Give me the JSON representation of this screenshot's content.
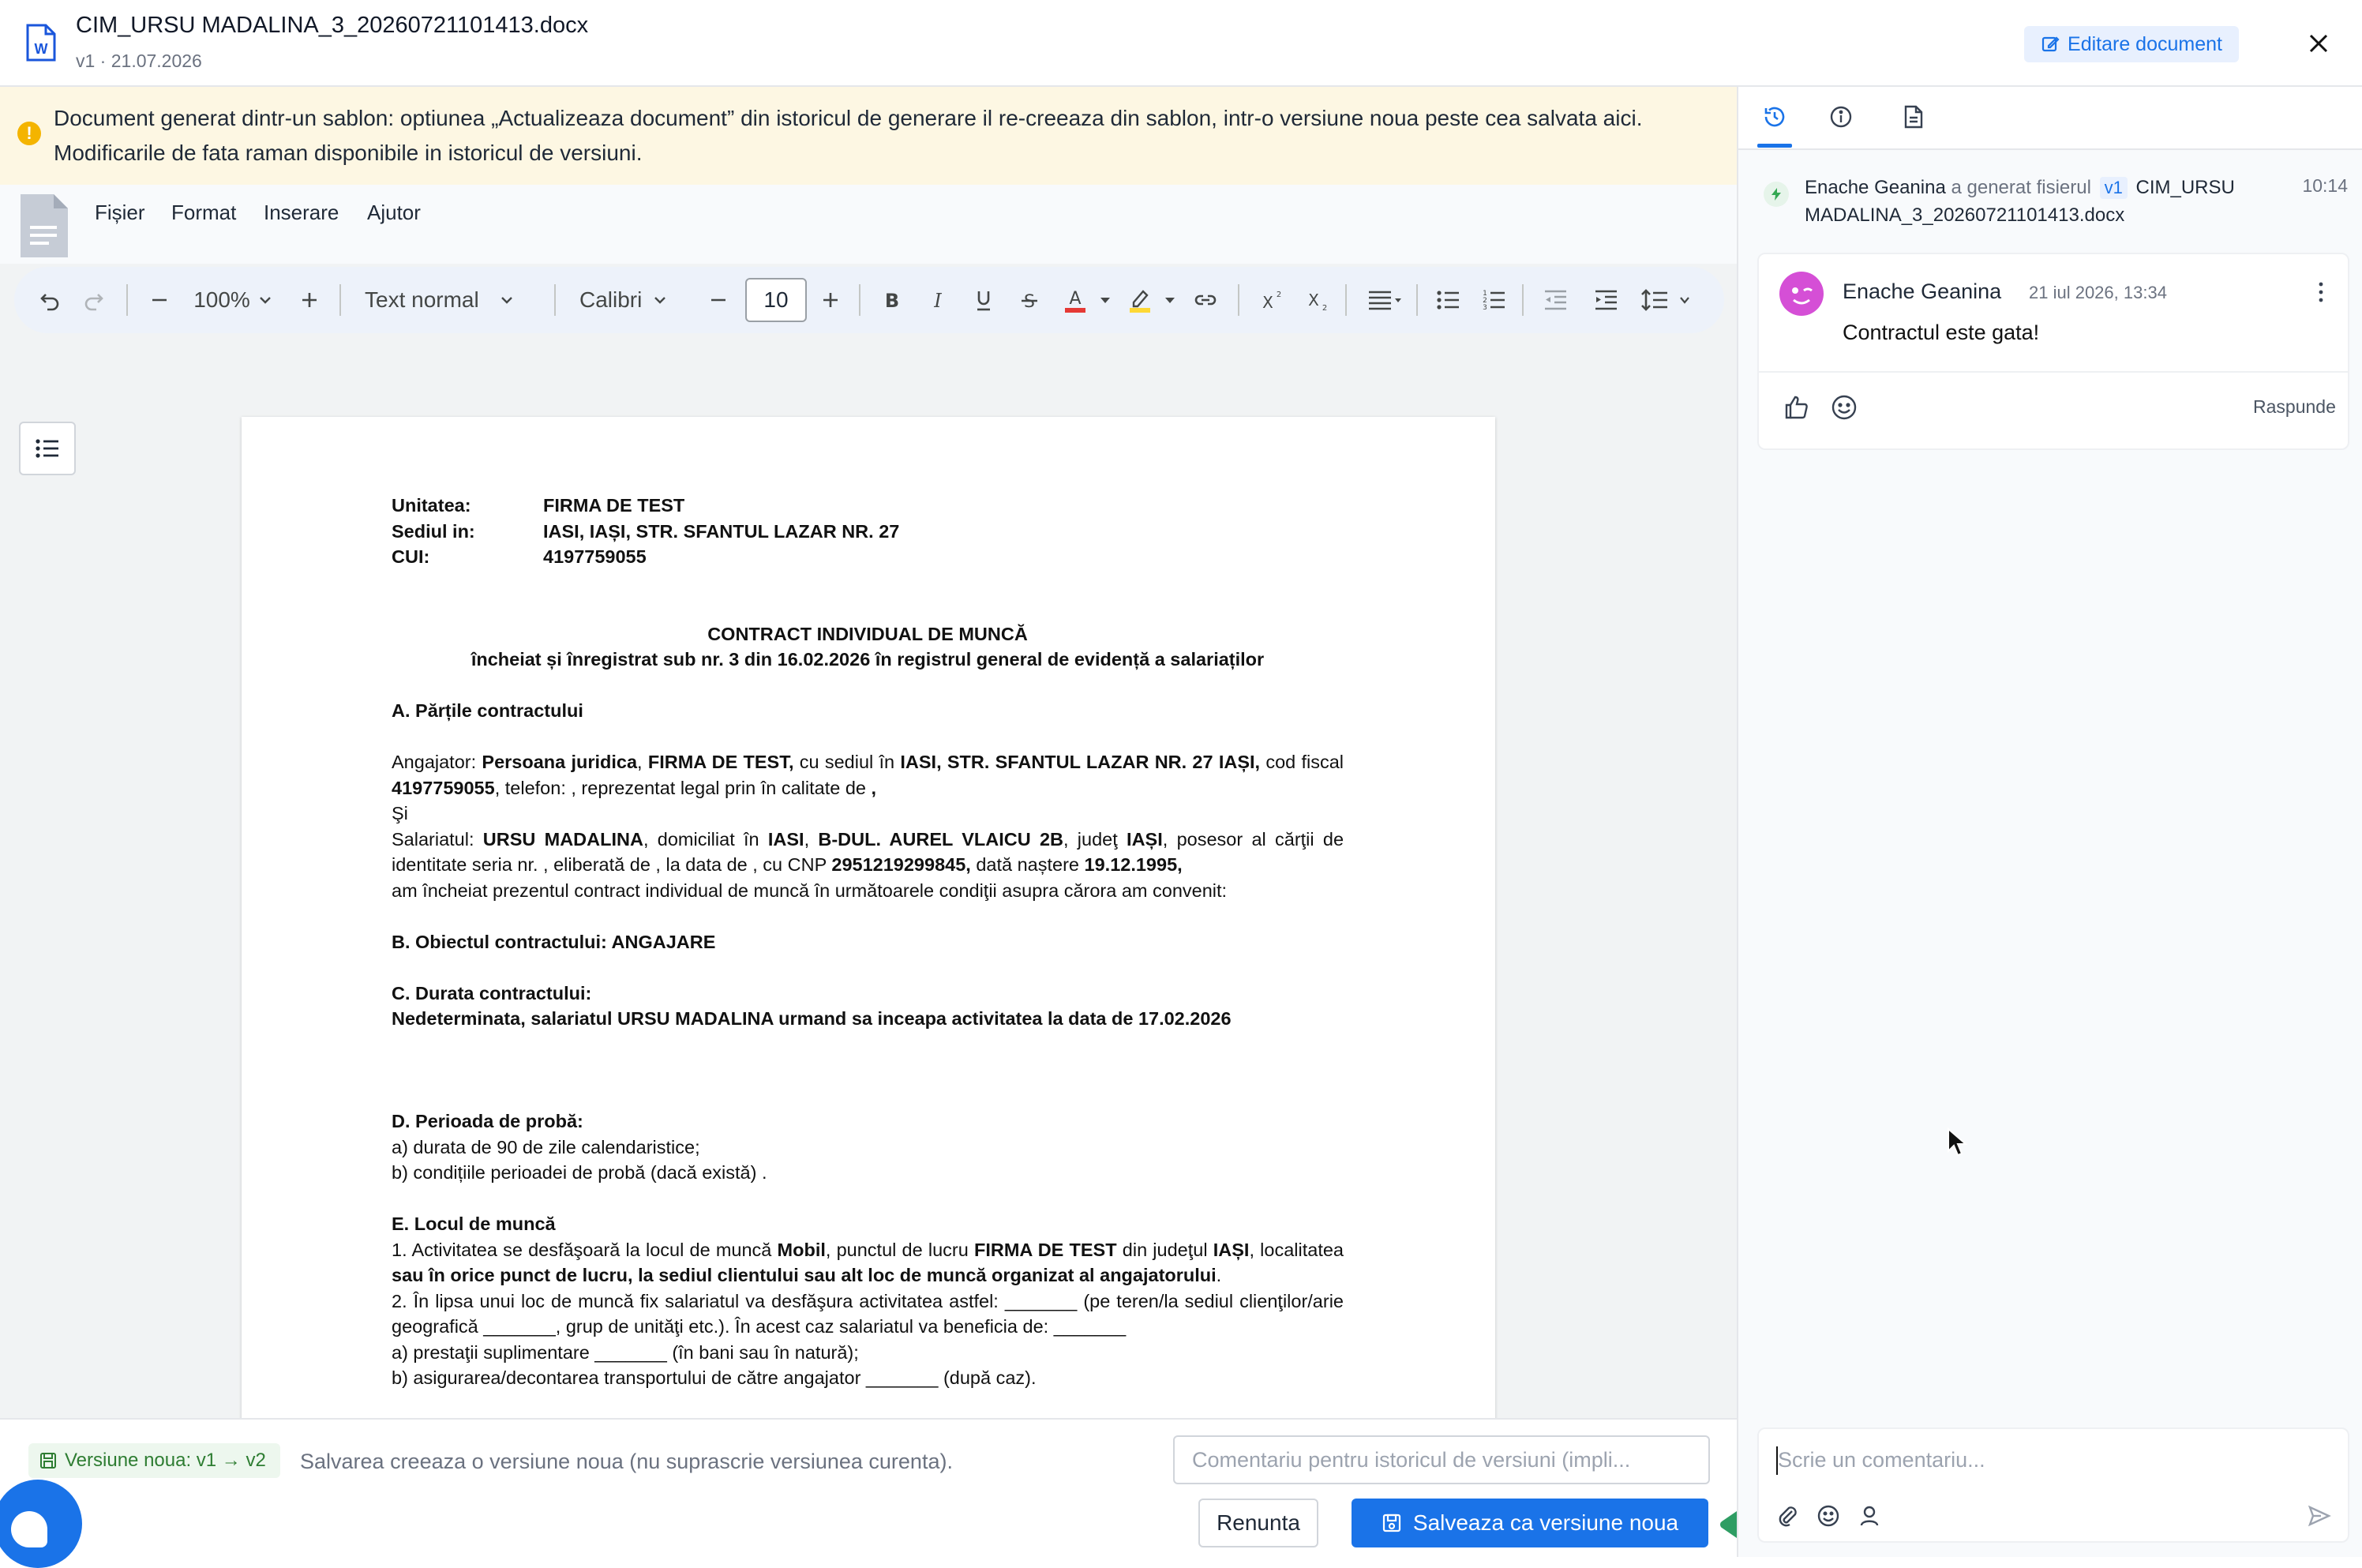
{
  "header": {
    "file_name": "CIM_URSU MADALINA_3_20260721101413.docx",
    "file_meta": "v1 · 21.07.2026",
    "edit_label": "Editare document"
  },
  "banner": {
    "text": "Document generat dintr-un sablon: optiunea „Actualizeaza document” din istoricul de generare il re-creeaza din sablon, intr-o versiune noua peste cea salvata aici. Modificarile de fata raman disponibile in istoricul de versiuni."
  },
  "menu": {
    "file": "Fișier",
    "format": "Format",
    "insert": "Inserare",
    "help": "Ajutor"
  },
  "toolbar": {
    "zoom": "100%",
    "style": "Text normal",
    "font": "Calibri",
    "font_size": "10",
    "text_color": "#e53935",
    "highlight_color": "#fdd835"
  },
  "document": {
    "unit_label": "Unitatea:",
    "unit_value": "FIRMA DE TEST",
    "seat_label": "Sediul in:",
    "seat_value": "IASI, IAȘI, STR. SFANTUL LAZAR NR. 27",
    "cui_label": "CUI:",
    "cui_value": "4197759055",
    "title": "CONTRACT INDIVIDUAL DE MUNCĂ",
    "subtitle": "încheiat și înregistrat sub nr. 3 din 16.02.2026 în registrul general de evidență a salariaților",
    "sec_a": "A. Părțile contractului",
    "employer_intro": "Angajator: ",
    "employer_type": "Persoana juridica",
    "employer_name": "FIRMA DE TEST,",
    "employer_seat_intro": " cu sediul în ",
    "employer_seat": "IASI, STR. SFANTUL LAZAR NR. 27 IAȘI,",
    "employer_cf_intro": " cod fiscal ",
    "employer_cf": "4197759055",
    "employer_rest": ", telefon: , reprezentat legal prin  în calitate de ",
    "employer_end": ",",
    "and": "Şi",
    "employee_intro": "Salariatul: ",
    "employee_name": "URSU MADALINA",
    "employee_dom_intro": ", domiciliat în ",
    "employee_city": "IASI",
    "employee_street": "B-DUL. AUREL VLAICU 2B",
    "employee_county_intro": ", judeţ ",
    "employee_county": "IAȘI",
    "employee_id_text": ", posesor al cărţii de identitate seria  nr. , eliberată de , la data de , cu CNP ",
    "employee_cnp": "2951219299845,",
    "employee_birth_intro": " dată naștere ",
    "employee_birth": "19.12.1995,",
    "agreement": "am încheiat prezentul contract individual de muncă în următoarele condiţii asupra cărora am convenit:",
    "sec_b": "B. Obiectul contractului: ANGAJARE",
    "sec_c": "C.  Durata contractului:",
    "sec_c_text": "Nedeterminata, salariatul URSU MADALINA urmand sa inceapa activitatea la data de 17.02.2026",
    "sec_d": "D. Perioada de probă:",
    "sec_d_a": "a) durata de 90 de  zile calendaristice;",
    "sec_d_b": "b) condițiile perioadei de probă (dacă există) .",
    "sec_e": "E. Locul de muncă",
    "e1_a": "1. Activitatea se desfăşoară la locul de muncă ",
    "e1_mobil": "Mobil",
    "e1_b": ", punctul de lucru ",
    "e1_firm": "FIRMA DE TEST",
    "e1_c": " din judeţul ",
    "e1_county": "IAȘI",
    "e1_d": ", localitatea  ",
    "e1_place": " sau în orice punct de lucru, la sediul clientului sau alt loc de muncă organizat al angajatorului",
    "e1_end": ".",
    "e2": "2. În lipsa unui loc de muncă fix salariatul va desfăşura activitatea astfel: _______ (pe teren/la sediul clienţilor/arie geografică _______, grup de unităţi etc.). În acest caz salariatul va beneficia de: _______",
    "e2_a": "a) prestaţii suplimentare _______ (în bani sau în natură);",
    "e2_b": "b) asigurarea/decontarea transportului de către angajator _______ (după caz)."
  },
  "bottom": {
    "version_badge": "Versiune noua: v1 → v2",
    "version_note": "Salvarea creeaza o versiune noua (nu suprascrie versiunea curenta).",
    "comment_placeholder": "Comentariu pentru istoricul de versiuni (impli...",
    "cancel_label": "Renunta",
    "save_label": "Salveaza ca versiune noua"
  },
  "sidebar": {
    "event": {
      "author": "Enache Geanina",
      "action": " a generat fisierul ",
      "version": "v1",
      "file": " CIM_URSU MADALINA_3_20260721101413.docx",
      "time": "10:14"
    },
    "comment": {
      "author": "Enache Geanina",
      "date": "21 iul 2026, 13:34",
      "text": "Contractul este gata!",
      "reply_label": "Raspunde"
    },
    "new_comment_placeholder": "Scrie un comentariu..."
  },
  "colors": {
    "accent": "#1a73e8",
    "banner_bg": "#fdf7e3",
    "success": "#2e7d32",
    "avatar": "#d54fd6"
  }
}
